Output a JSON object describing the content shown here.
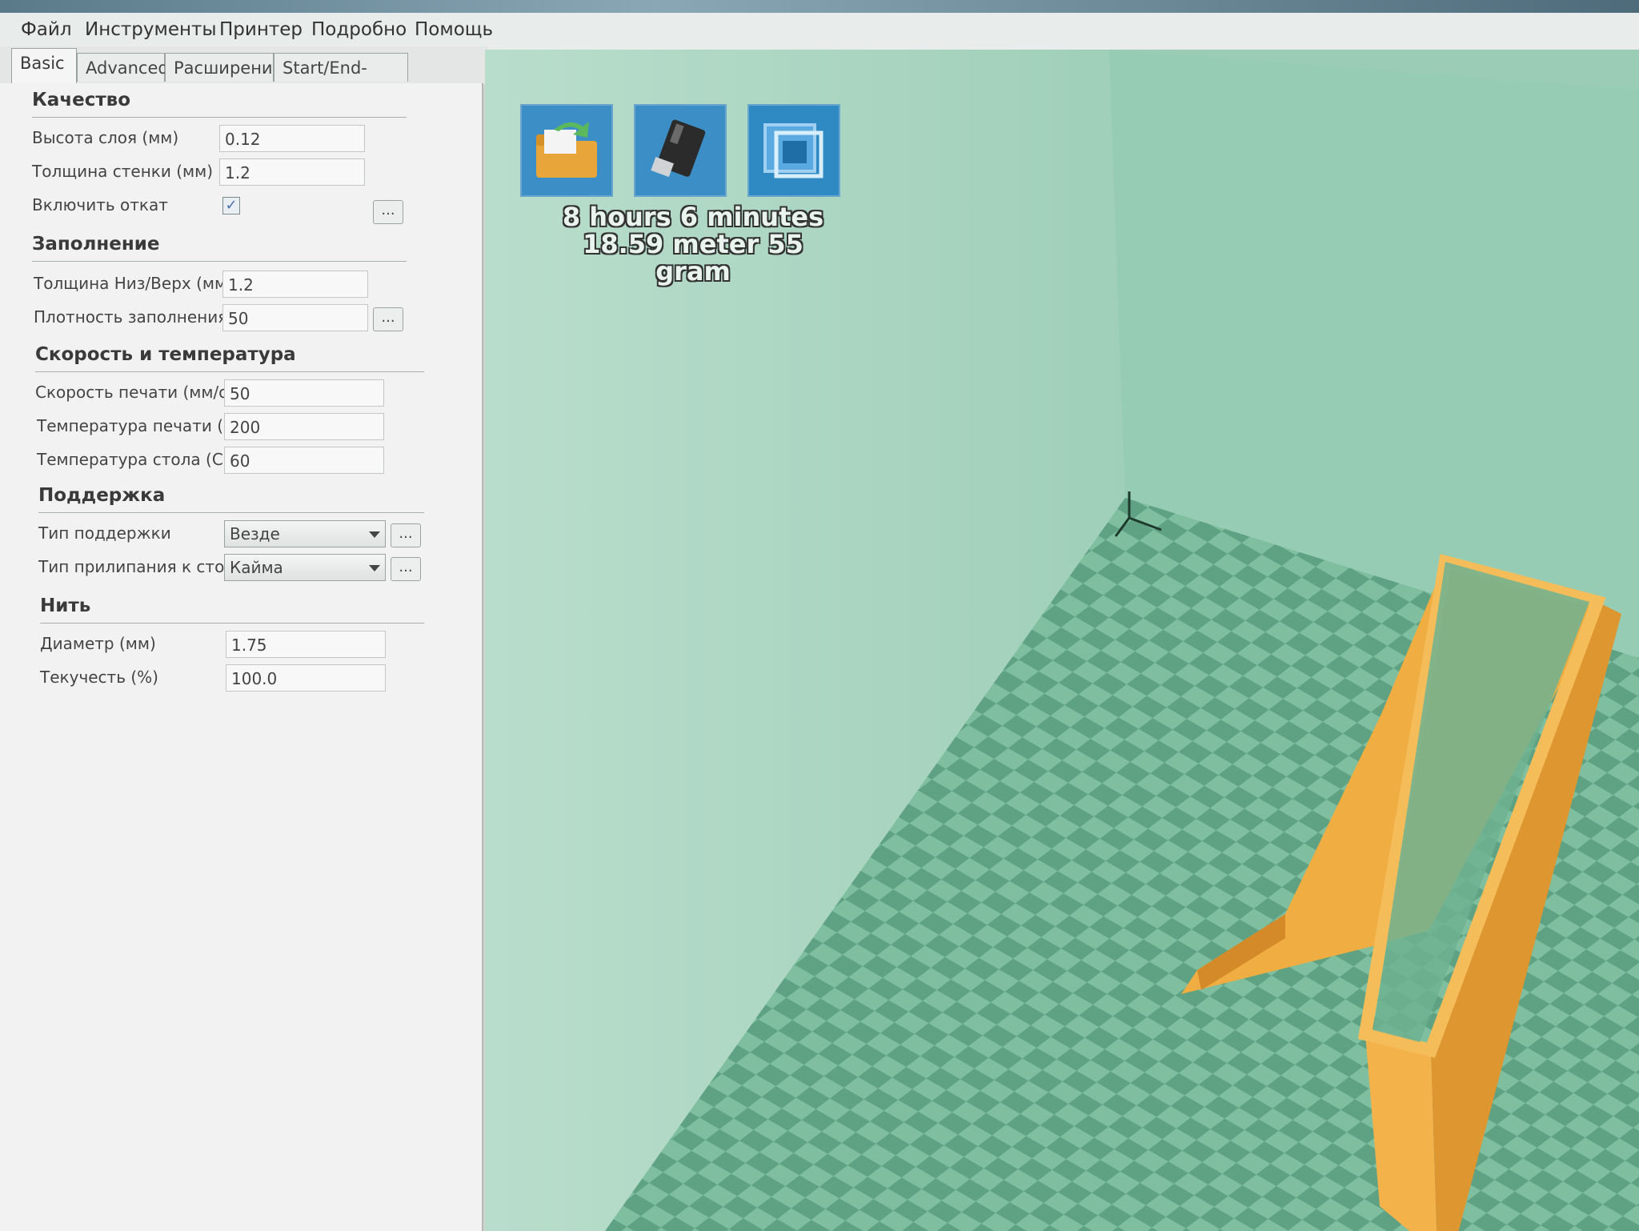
{
  "menu": [
    "Файл",
    "Инструменты",
    "Принтер",
    "Подробно",
    "Помощь"
  ],
  "tabs": [
    "Basic",
    "Advanced",
    "Расширения",
    "Start/End-GCode"
  ],
  "quality": {
    "title": "Качество",
    "layer_height_label": "Высота слоя (мм)",
    "layer_height": "0.12",
    "wall_thickness_label": "Толщина стенки (мм)",
    "wall_thickness": "1.2",
    "retraction_label": "Включить откат",
    "retraction_checked": true
  },
  "fill": {
    "title": "Заполнение",
    "bottom_top_label": "Толщина Низ/Верх (мм)",
    "bottom_top": "1.2",
    "density_label": "Плотность заполнения",
    "density": "50"
  },
  "speed": {
    "title": "Скорость и температура",
    "print_speed_label": "Скорость печати (мм/с)",
    "print_speed": "50",
    "print_temp_label": "Температура печати (C)",
    "print_temp": "200",
    "bed_temp_label": "Температура стола (C)",
    "bed_temp": "60"
  },
  "support": {
    "title": "Поддержка",
    "type_label": "Тип поддержки",
    "type": "Везде",
    "adhesion_label": "Тип прилипания к столу",
    "adhesion": "Кайма"
  },
  "filament": {
    "title": "Нить",
    "diameter_label": "Диаметр (мм)",
    "diameter": "1.75",
    "flow_label": "Текучесть (%)",
    "flow": "100.0"
  },
  "dots_label": "...",
  "viewport": {
    "time": "8 hours 6 minutes",
    "material": "18.59 meter 55 gram",
    "toolbar": [
      "load-folder-icon",
      "usb-drive-icon",
      "view-mode-icon"
    ]
  },
  "colors": {
    "bed": "#7fbf9f",
    "bed_dark": "#5fa283",
    "model": "#e8a23a",
    "wall": "#a9d6c1"
  }
}
